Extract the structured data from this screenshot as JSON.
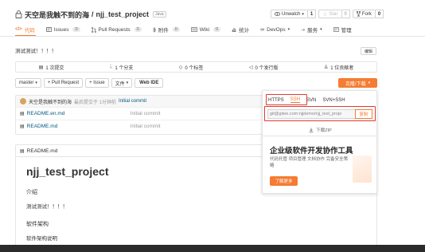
{
  "repo": {
    "owner": "天空是我触不到的海",
    "separator": "/",
    "name": "njj_test_project",
    "lang_badge": "Java"
  },
  "actions": {
    "unwatch_label": "Unwatch",
    "unwatch_count": "1",
    "star_label": "Star",
    "star_count": "0",
    "fork_label": "Fork",
    "fork_count": "0"
  },
  "tabs": [
    {
      "label": "代码",
      "count": ""
    },
    {
      "label": "Issues",
      "count": "0"
    },
    {
      "label": "Pull Requests",
      "count": "0"
    },
    {
      "label": "附件",
      "count": "0"
    },
    {
      "label": "Wiki",
      "count": "0"
    },
    {
      "label": "统计",
      "count": ""
    },
    {
      "label": "DevOps",
      "count": ""
    },
    {
      "label": "服务",
      "count": ""
    },
    {
      "label": "管理",
      "count": ""
    }
  ],
  "description": "测试测试！！！！",
  "edit_label": "编辑",
  "stats": {
    "commits": "1 次提交",
    "branches": "1 个分支",
    "tags": "0 个标签",
    "releases": "0 个发行版",
    "contributors": "1 位贡献者"
  },
  "toolbar": {
    "branch": "master",
    "pull_request": "+ Pull Request",
    "issue": "+ Issue",
    "files": "文件",
    "web_ide": "Web IDE",
    "clone_download": "克隆/下载"
  },
  "latest_commit": {
    "author": "天空是我触不到的海",
    "meta": "最后提交于 1分钟前",
    "message": "Initial commit"
  },
  "files": [
    {
      "name": "README.en.md",
      "commit": "Initial commit"
    },
    {
      "name": "README.md",
      "commit": "Initial commit"
    }
  ],
  "readme": {
    "filename": "README.md",
    "title": "njj_test_project",
    "section1": "介绍",
    "text1": "测试测试！！！！",
    "section2": "软件架构",
    "text2": "软件架构说明"
  },
  "clone_panel": {
    "tabs": [
      "HTTPS",
      "SSH",
      "SVN",
      "SVN+SSH"
    ],
    "active_tab": "SSH",
    "url": "git@gitee.com:njjdemo/njj_test_proje",
    "copy_label": "复制",
    "download_zip": "下载ZIP",
    "promo_title": "企业级软件开发协作工具",
    "promo_desc": "代码托管 项目管理 文档协作 完备安全策略",
    "promo_button": "了解更多"
  },
  "colors": {
    "accent": "#f57c32",
    "highlight_box": "#e03c31",
    "link": "#005980"
  }
}
